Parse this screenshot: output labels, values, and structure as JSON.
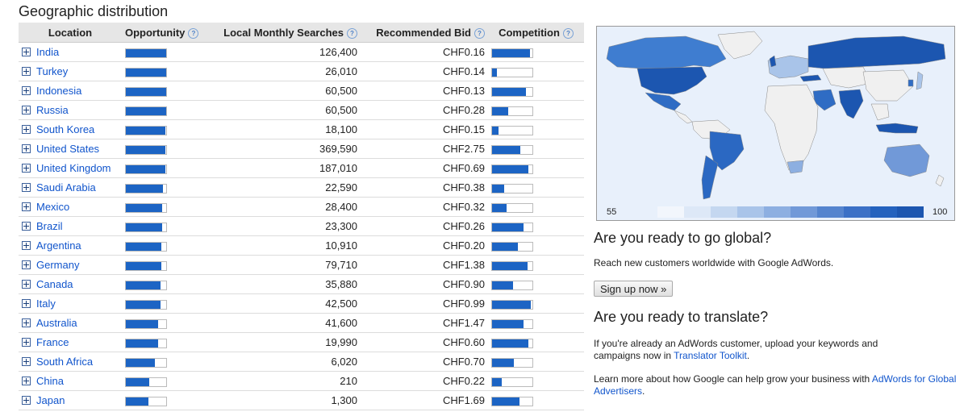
{
  "title": "Geographic distribution",
  "columns": {
    "location": "Location",
    "opportunity": "Opportunity",
    "searches": "Local Monthly Searches",
    "bid": "Recommended Bid",
    "competition": "Competition"
  },
  "rows": [
    {
      "location": "India",
      "opportunity": 1.0,
      "searches": "126,400",
      "bid": "CHF0.16",
      "competition": 0.94
    },
    {
      "location": "Turkey",
      "opportunity": 1.0,
      "searches": "26,010",
      "bid": "CHF0.14",
      "competition": 0.12
    },
    {
      "location": "Indonesia",
      "opportunity": 0.99,
      "searches": "60,500",
      "bid": "CHF0.13",
      "competition": 0.84
    },
    {
      "location": "Russia",
      "opportunity": 0.99,
      "searches": "60,500",
      "bid": "CHF0.28",
      "competition": 0.4
    },
    {
      "location": "South Korea",
      "opportunity": 0.98,
      "searches": "18,100",
      "bid": "CHF0.15",
      "competition": 0.16
    },
    {
      "location": "United States",
      "opportunity": 0.98,
      "searches": "369,590",
      "bid": "CHF2.75",
      "competition": 0.7
    },
    {
      "location": "United Kingdom",
      "opportunity": 0.98,
      "searches": "187,010",
      "bid": "CHF0.69",
      "competition": 0.9
    },
    {
      "location": "Saudi Arabia",
      "opportunity": 0.92,
      "searches": "22,590",
      "bid": "CHF0.38",
      "competition": 0.3
    },
    {
      "location": "Mexico",
      "opportunity": 0.9,
      "searches": "28,400",
      "bid": "CHF0.32",
      "competition": 0.36
    },
    {
      "location": "Brazil",
      "opportunity": 0.9,
      "searches": "23,300",
      "bid": "CHF0.26",
      "competition": 0.78
    },
    {
      "location": "Argentina",
      "opportunity": 0.88,
      "searches": "10,910",
      "bid": "CHF0.20",
      "competition": 0.64
    },
    {
      "location": "Germany",
      "opportunity": 0.88,
      "searches": "79,710",
      "bid": "CHF1.38",
      "competition": 0.88
    },
    {
      "location": "Canada",
      "opportunity": 0.86,
      "searches": "35,880",
      "bid": "CHF0.90",
      "competition": 0.52
    },
    {
      "location": "Italy",
      "opportunity": 0.86,
      "searches": "42,500",
      "bid": "CHF0.99",
      "competition": 0.96
    },
    {
      "location": "Australia",
      "opportunity": 0.8,
      "searches": "41,600",
      "bid": "CHF1.47",
      "competition": 0.78
    },
    {
      "location": "France",
      "opportunity": 0.8,
      "searches": "19,990",
      "bid": "CHF0.60",
      "competition": 0.9
    },
    {
      "location": "South Africa",
      "opportunity": 0.72,
      "searches": "6,020",
      "bid": "CHF0.70",
      "competition": 0.54
    },
    {
      "location": "China",
      "opportunity": 0.58,
      "searches": "210",
      "bid": "CHF0.22",
      "competition": 0.24
    },
    {
      "location": "Japan",
      "opportunity": 0.56,
      "searches": "1,300",
      "bid": "CHF1.69",
      "competition": 0.68
    }
  ],
  "help_icon": "question-mark-icon",
  "expand_icon": "plus-icon",
  "colors": {
    "bar": "#1c64c4",
    "link": "#1155cc",
    "map_ocean": "#e8f0fb",
    "map_max": "#1c5fbf"
  },
  "map_legend": {
    "min": "55",
    "max": "100",
    "scale": [
      "#f2f6fc",
      "#dde8f7",
      "#c4d7f0",
      "#a9c4e9",
      "#8dafe1",
      "#7199d8",
      "#5584ce",
      "#3b70c6",
      "#2462be",
      "#1c56b0"
    ]
  },
  "global": {
    "heading": "Are you ready to go global?",
    "text": "Reach new customers worldwide with Google AdWords.",
    "button": "Sign up now »"
  },
  "translate": {
    "heading": "Are you ready to translate?",
    "text1_pre": "If you're already an AdWords customer, upload your keywords and campaigns now in ",
    "text1_link": "Translator Toolkit",
    "text1_post": ".",
    "text2_pre": "Learn more about how Google can help grow your business with ",
    "text2_link": "AdWords for Global Advertisers",
    "text2_post": "."
  }
}
